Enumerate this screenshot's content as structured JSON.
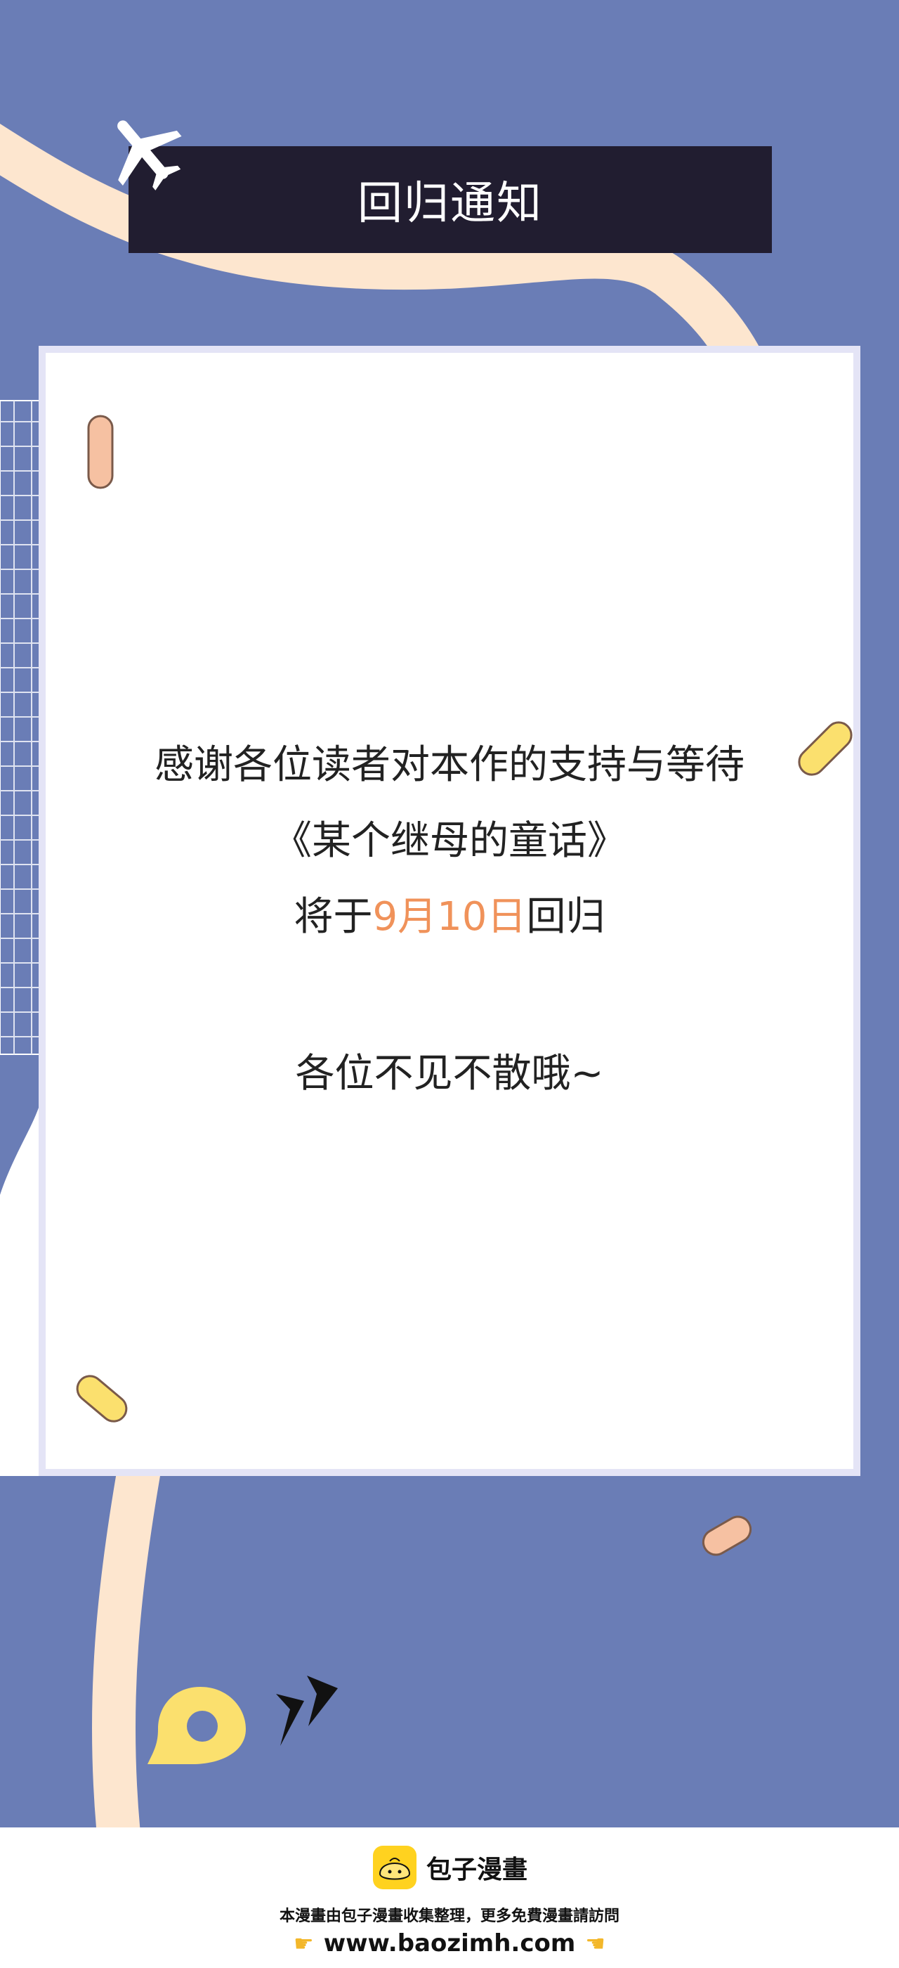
{
  "notice": {
    "title": "回归通知",
    "line1": "感谢各位读者对本作的支持与等待",
    "line2": "《某个继母的童话》",
    "line3_prefix": "将于",
    "line3_date": "9月10日",
    "line3_suffix": "回归",
    "line4": "各位不见不散哦~"
  },
  "footer": {
    "brand_name": "包子漫畫",
    "note": "本漫畫由包子漫畫收集整理，更多免費漫畫請訪問",
    "url": "www.baozimh.com"
  },
  "icons": {
    "plane": "airplane-icon",
    "brand": "baozi-bun-logo-icon",
    "pointer_left": "pointing-right-hand-icon",
    "pointer_right": "pointing-left-hand-icon",
    "location": "location-pin-icon",
    "arrows": "double-chevron-icon"
  },
  "colors": {
    "background": "#6a7db6",
    "banner": "#211d30",
    "road": "#fde6cf",
    "highlight": "#f0925a",
    "yellow": "#fbe06e",
    "peach": "#f6c1a2"
  }
}
